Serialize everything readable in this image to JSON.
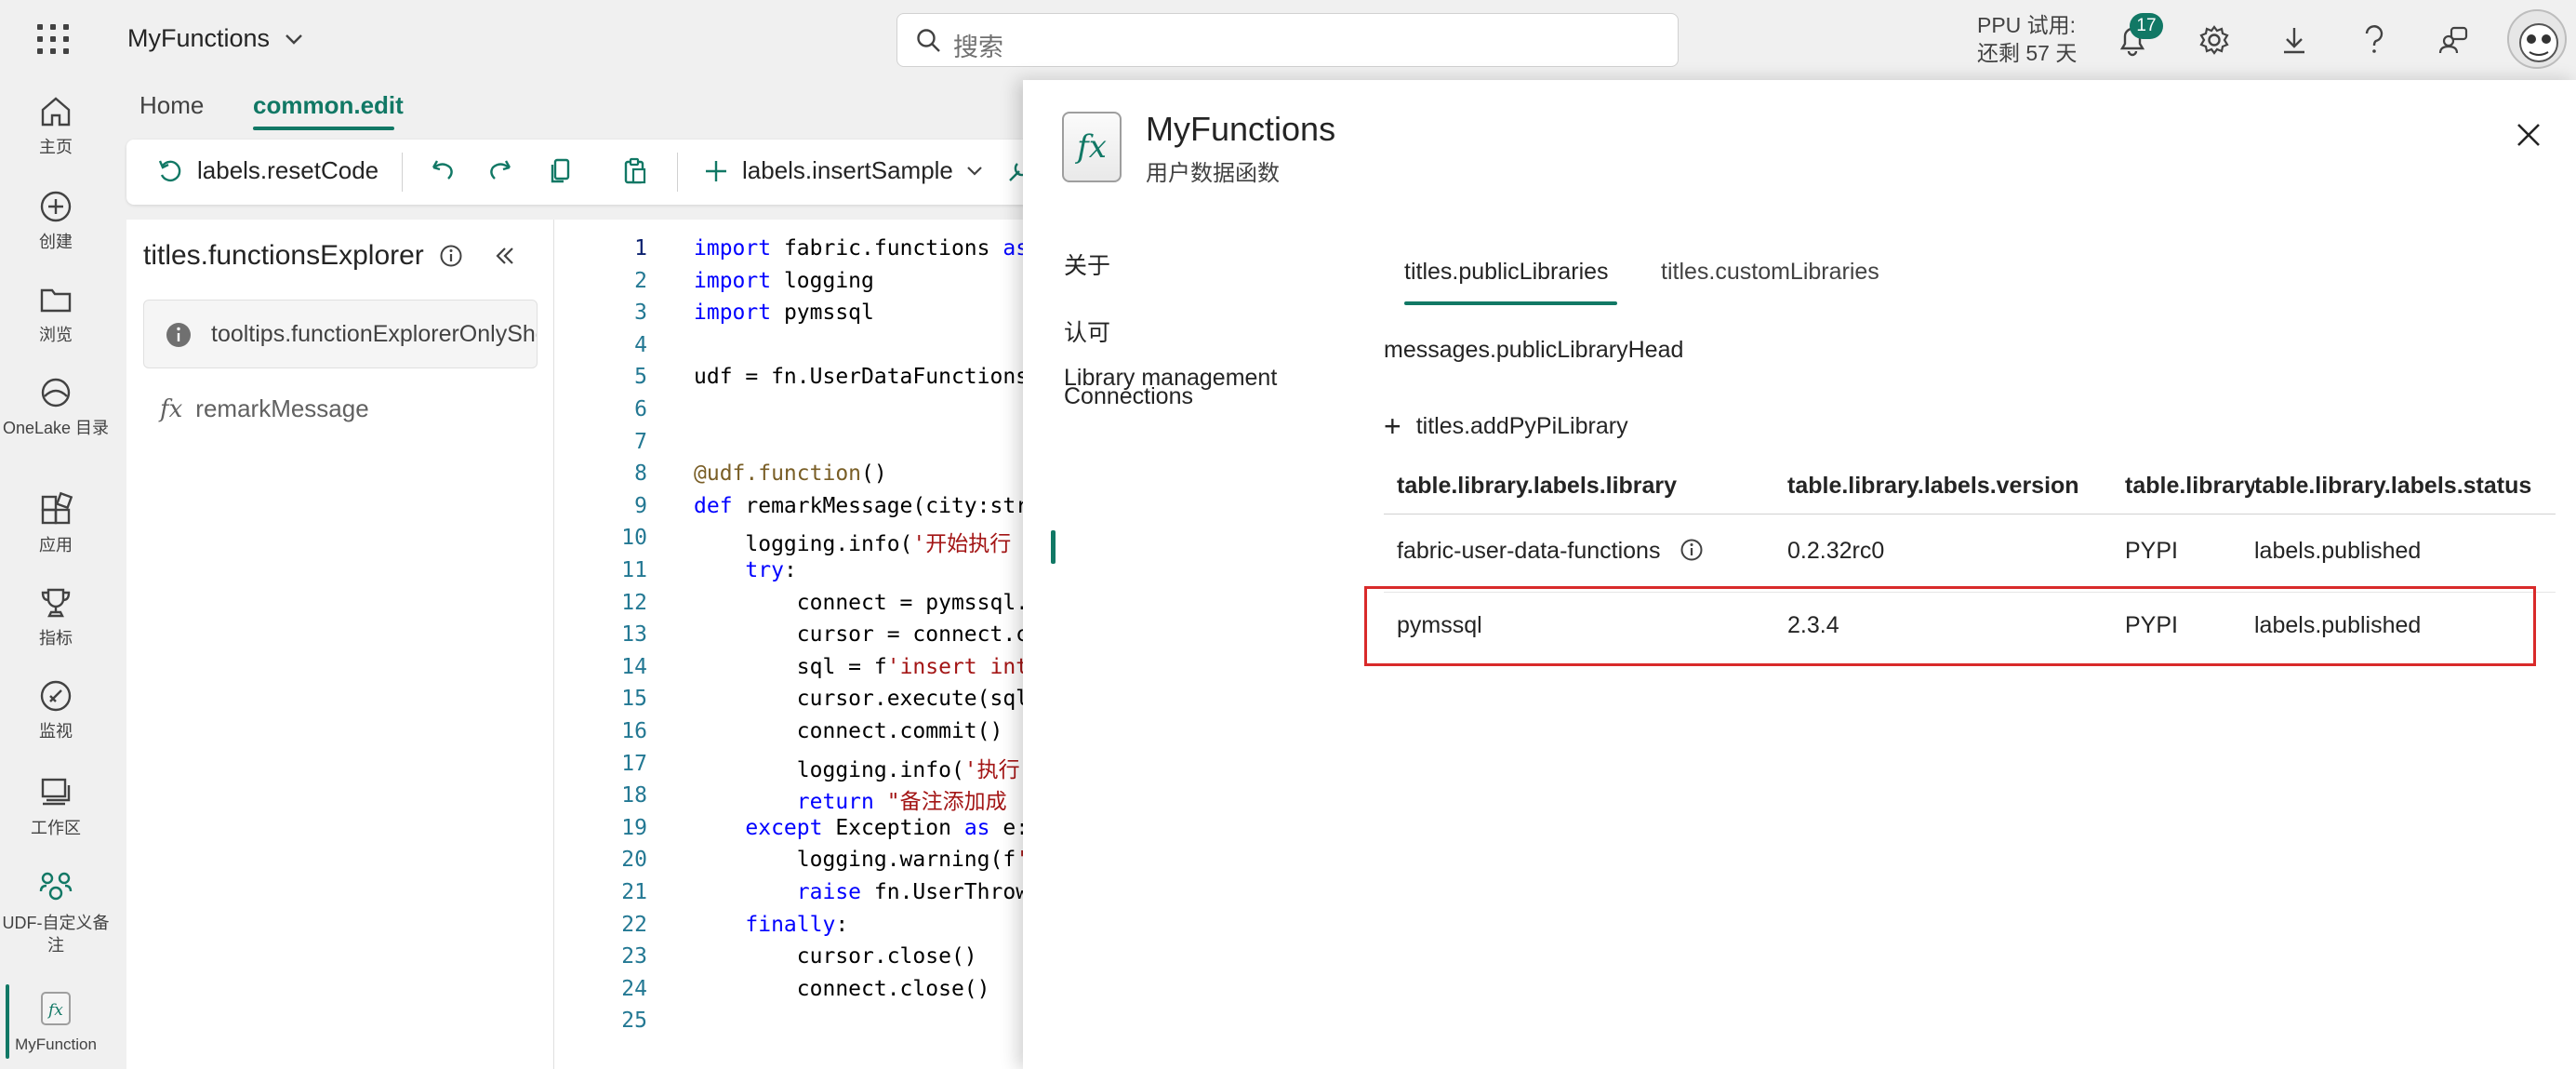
{
  "header": {
    "app_name": "MyFunctions",
    "search_placeholder": "搜索",
    "trial_line1": "PPU 试用:",
    "trial_line2": "还剩 57 天",
    "notification_count": "17",
    "icons": [
      "waffle-icon",
      "search-icon",
      "bell-icon",
      "gear-icon",
      "download-icon",
      "help-icon",
      "share-icon",
      "avatar"
    ]
  },
  "rail": {
    "items": [
      {
        "label": "主页",
        "icon": "home-icon"
      },
      {
        "label": "创建",
        "icon": "create-icon"
      },
      {
        "label": "浏览",
        "icon": "folder-icon"
      },
      {
        "label": "OneLake 目录",
        "icon": "onelake-icon"
      },
      {
        "label": "应用",
        "icon": "apps-icon"
      },
      {
        "label": "指标",
        "icon": "trophy-icon"
      },
      {
        "label": "监视",
        "icon": "monitor-icon"
      },
      {
        "label": "工作区",
        "icon": "workspace-icon"
      },
      {
        "label": "UDF-自定义备注",
        "icon": "udf-icon"
      },
      {
        "label": "MyFunction",
        "icon": "function-icon"
      }
    ]
  },
  "editor": {
    "tabs": [
      {
        "label": "Home"
      },
      {
        "label": "common.edit"
      }
    ],
    "ribbon": {
      "reset": "labels.resetCode",
      "insert": "labels.insertSample"
    },
    "explorer_title": "titles.functionsExplorer",
    "explorer_tooltip": "tooltips.functionExplorerOnlyShow",
    "function_item": "remarkMessage",
    "code_lines": [
      {
        "n": "1",
        "t": "import fabric.functions as"
      },
      {
        "n": "2",
        "t": "import logging"
      },
      {
        "n": "3",
        "t": "import pymssql"
      },
      {
        "n": "4",
        "t": ""
      },
      {
        "n": "5",
        "t": "udf = fn.UserDataFunctions"
      },
      {
        "n": "6",
        "t": ""
      },
      {
        "n": "7",
        "t": ""
      },
      {
        "n": "8",
        "t": "@udf.function()"
      },
      {
        "n": "9",
        "t": "def remarkMessage(city:str"
      },
      {
        "n": "10",
        "t": "    logging.info('开始执行"
      },
      {
        "n": "11",
        "t": "    try:"
      },
      {
        "n": "12",
        "t": "        connect = pymssql."
      },
      {
        "n": "13",
        "t": "        cursor = connect.c"
      },
      {
        "n": "14",
        "t": "        sql = f'insert int"
      },
      {
        "n": "15",
        "t": "        cursor.execute(sql"
      },
      {
        "n": "16",
        "t": "        connect.commit()"
      },
      {
        "n": "17",
        "t": "        logging.info('执行"
      },
      {
        "n": "18",
        "t": "        return \"备注添加成"
      },
      {
        "n": "19",
        "t": "    except Exception as e:"
      },
      {
        "n": "20",
        "t": "        logging.warning(f'"
      },
      {
        "n": "21",
        "t": "        raise fn.UserThrow"
      },
      {
        "n": "22",
        "t": "    finally:"
      },
      {
        "n": "23",
        "t": "        cursor.close()"
      },
      {
        "n": "24",
        "t": "        connect.close()"
      },
      {
        "n": "25",
        "t": ""
      }
    ]
  },
  "panel": {
    "title": "MyFunctions",
    "subtitle": "用户数据函数",
    "nav": [
      {
        "label": "关于"
      },
      {
        "label": "认可"
      },
      {
        "label": "Connections"
      },
      {
        "label": "Library management"
      }
    ],
    "tabs": [
      {
        "label": "titles.publicLibraries"
      },
      {
        "label": "titles.customLibraries"
      }
    ],
    "head_message": "messages.publicLibraryHead",
    "add_library": "titles.addPyPiLibrary",
    "table": {
      "headers": {
        "library": "table.library.labels.library",
        "version": "table.library.labels.version",
        "source": "table.library.labels.source",
        "status": "table.library.labels.status"
      },
      "rows": [
        {
          "library": "fabric-user-data-functions",
          "version": "0.2.32rc0",
          "source": "PYPI",
          "status": "labels.published"
        },
        {
          "library": "pymssql",
          "version": "2.3.4",
          "source": "PYPI",
          "status": "labels.published"
        }
      ]
    },
    "highlight_color": "#d92a2a",
    "accent": "#117865"
  }
}
